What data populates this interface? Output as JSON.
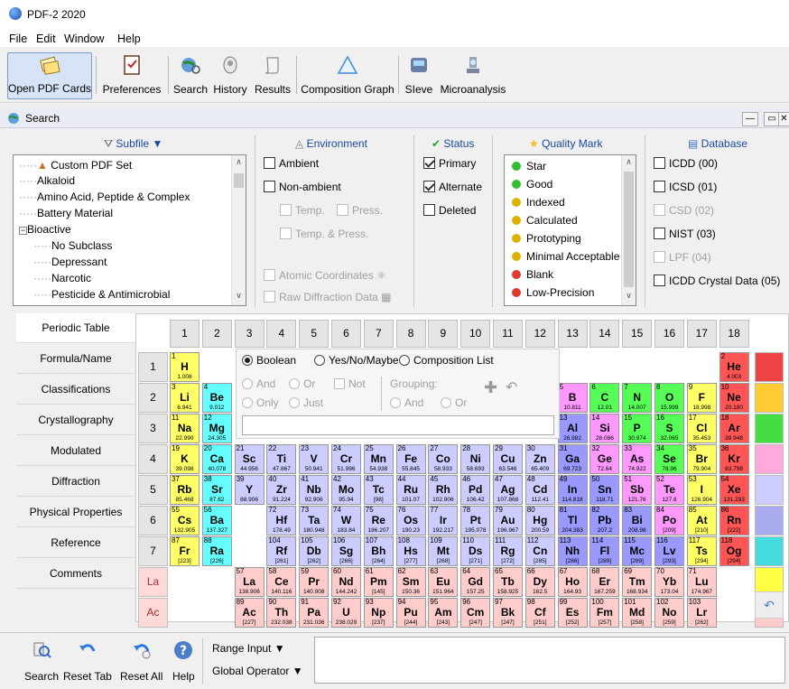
{
  "app_title": "PDF-2 2020",
  "menu": [
    "File",
    "Edit",
    "Window",
    "Help"
  ],
  "toolbar": {
    "open_pdf_cards": "Open PDF Cards",
    "preferences": "Preferences",
    "search": "Search",
    "history": "History",
    "results": "Results",
    "composition_graph": "Composition Graph",
    "sieve": "SIeve",
    "microanalysis": "Microanalysis"
  },
  "search_window": {
    "title": "Search"
  },
  "subfile": {
    "header": "Subfile ▼",
    "items": [
      "Custom PDF Set",
      "Alkaloid",
      "Amino Acid, Peptide & Complex",
      "Battery Material",
      "Bioactive",
      "No Subclass",
      "Depressant",
      "Narcotic",
      "Pesticide & Antimicrobial"
    ]
  },
  "environment": {
    "header": "Environment",
    "ambient": "Ambient",
    "non_ambient": "Non-ambient",
    "temp": "Temp.",
    "press": "Press.",
    "temp_press": "Temp. & Press.",
    "atomic_coordinates": "Atomic Coordinates",
    "raw_diffraction_data": "Raw Diffraction Data"
  },
  "status": {
    "header": "Status",
    "primary": "Primary",
    "alternate": "Alternate",
    "deleted": "Deleted"
  },
  "quality_mark": {
    "header": "Quality Mark",
    "items": [
      {
        "label": "Star",
        "color": "#2fbf2f"
      },
      {
        "label": "Good",
        "color": "#2fbf2f"
      },
      {
        "label": "Indexed",
        "color": "#e0b000"
      },
      {
        "label": "Calculated",
        "color": "#e0b000"
      },
      {
        "label": "Prototyping",
        "color": "#e0b000"
      },
      {
        "label": "Minimal Acceptable",
        "color": "#e0b000"
      },
      {
        "label": "Blank",
        "color": "#e03a2a"
      },
      {
        "label": "Low-Precision",
        "color": "#e03a2a"
      }
    ]
  },
  "database": {
    "header": "Database",
    "items": [
      "ICDD (00)",
      "ICSD (01)",
      "CSD (02)",
      "NIST (03)",
      "LPF (04)",
      "ICDD Crystal Data (05)"
    ]
  },
  "tabs": [
    "Periodic Table",
    "Formula/Name",
    "Classifications",
    "Crystallography",
    "Modulated",
    "Diffraction",
    "Physical Properties",
    "Reference",
    "Comments"
  ],
  "periodic": {
    "groups": [
      "1",
      "2",
      "3",
      "4",
      "5",
      "6",
      "7",
      "8",
      "9",
      "10",
      "11",
      "12",
      "13",
      "14",
      "15",
      "16",
      "17",
      "18"
    ],
    "periods": [
      "1",
      "2",
      "3",
      "4",
      "5",
      "6",
      "7",
      "La",
      "Ac"
    ],
    "options": {
      "boolean": "Boolean",
      "yes_no_maybe": "Yes/No/Maybe",
      "composition_list": "Composition List",
      "and": "And",
      "or": "Or",
      "not": "Not",
      "grouping": "Grouping:",
      "only": "Only",
      "just": "Just",
      "g_and": "And",
      "g_or": "Or"
    },
    "elements": [
      [
        "1",
        "H",
        "1.008",
        1,
        1,
        "y"
      ],
      [
        "2",
        "He",
        "4.003",
        18,
        1,
        "r"
      ],
      [
        "3",
        "Li",
        "6.941",
        1,
        2,
        "y"
      ],
      [
        "4",
        "Be",
        "9.012",
        2,
        2,
        "c"
      ],
      [
        "5",
        "B",
        "10.811",
        13,
        2,
        "p"
      ],
      [
        "6",
        "C",
        "12.01",
        14,
        2,
        "g"
      ],
      [
        "7",
        "N",
        "14.007",
        15,
        2,
        "g"
      ],
      [
        "8",
        "O",
        "15.999",
        16,
        2,
        "g"
      ],
      [
        "9",
        "F",
        "18.998",
        17,
        2,
        "y"
      ],
      [
        "10",
        "Ne",
        "20.180",
        18,
        2,
        "r"
      ],
      [
        "11",
        "Na",
        "22.990",
        1,
        3,
        "y"
      ],
      [
        "12",
        "Mg",
        "24.305",
        2,
        3,
        "c"
      ],
      [
        "13",
        "Al",
        "26.982",
        13,
        3,
        "b"
      ],
      [
        "14",
        "Si",
        "28.086",
        14,
        3,
        "p"
      ],
      [
        "15",
        "P",
        "30.974",
        15,
        3,
        "g"
      ],
      [
        "16",
        "S",
        "32.065",
        16,
        3,
        "g"
      ],
      [
        "17",
        "Cl",
        "35.453",
        17,
        3,
        "y"
      ],
      [
        "18",
        "Ar",
        "39.948",
        18,
        3,
        "r"
      ],
      [
        "19",
        "K",
        "39.098",
        1,
        4,
        "y"
      ],
      [
        "20",
        "Ca",
        "40.078",
        2,
        4,
        "c"
      ],
      [
        "21",
        "Sc",
        "44.956",
        3,
        4,
        "l"
      ],
      [
        "22",
        "Ti",
        "47.867",
        4,
        4,
        "l"
      ],
      [
        "23",
        "V",
        "50.941",
        5,
        4,
        "l"
      ],
      [
        "24",
        "Cr",
        "51.996",
        6,
        4,
        "l"
      ],
      [
        "25",
        "Mn",
        "54.938",
        7,
        4,
        "l"
      ],
      [
        "26",
        "Fe",
        "55.845",
        8,
        4,
        "l"
      ],
      [
        "27",
        "Co",
        "58.933",
        9,
        4,
        "l"
      ],
      [
        "28",
        "Ni",
        "58.693",
        10,
        4,
        "l"
      ],
      [
        "29",
        "Cu",
        "63.546",
        11,
        4,
        "l"
      ],
      [
        "30",
        "Zn",
        "65.409",
        12,
        4,
        "l"
      ],
      [
        "31",
        "Ga",
        "69.723",
        13,
        4,
        "b"
      ],
      [
        "32",
        "Ge",
        "72.64",
        14,
        4,
        "p"
      ],
      [
        "33",
        "As",
        "74.922",
        15,
        4,
        "p"
      ],
      [
        "34",
        "Se",
        "78.96",
        16,
        4,
        "g"
      ],
      [
        "35",
        "Br",
        "79.904",
        17,
        4,
        "y"
      ],
      [
        "36",
        "Kr",
        "83.798",
        18,
        4,
        "r"
      ],
      [
        "37",
        "Rb",
        "85.468",
        1,
        5,
        "y"
      ],
      [
        "38",
        "Sr",
        "87.62",
        2,
        5,
        "c"
      ],
      [
        "39",
        "Y",
        "88.906",
        3,
        5,
        "l"
      ],
      [
        "40",
        "Zr",
        "91.224",
        4,
        5,
        "l"
      ],
      [
        "41",
        "Nb",
        "92.906",
        5,
        5,
        "l"
      ],
      [
        "42",
        "Mo",
        "95.94",
        6,
        5,
        "l"
      ],
      [
        "43",
        "Tc",
        "[98]",
        7,
        5,
        "l"
      ],
      [
        "44",
        "Ru",
        "101.07",
        8,
        5,
        "l"
      ],
      [
        "45",
        "Rh",
        "102.906",
        9,
        5,
        "l"
      ],
      [
        "46",
        "Pd",
        "106.42",
        10,
        5,
        "l"
      ],
      [
        "47",
        "Ag",
        "107.868",
        11,
        5,
        "l"
      ],
      [
        "48",
        "Cd",
        "112.41",
        12,
        5,
        "l"
      ],
      [
        "49",
        "In",
        "114.818",
        13,
        5,
        "b"
      ],
      [
        "50",
        "Sn",
        "118.71",
        14,
        5,
        "b"
      ],
      [
        "51",
        "Sb",
        "121.76",
        15,
        5,
        "p"
      ],
      [
        "52",
        "Te",
        "127.6",
        16,
        5,
        "p"
      ],
      [
        "53",
        "I",
        "126.904",
        17,
        5,
        "y"
      ],
      [
        "54",
        "Xe",
        "131.293",
        18,
        5,
        "r"
      ],
      [
        "55",
        "Cs",
        "132.905",
        1,
        6,
        "y"
      ],
      [
        "56",
        "Ba",
        "137.327",
        2,
        6,
        "c"
      ],
      [
        "72",
        "Hf",
        "178.49",
        4,
        6,
        "l"
      ],
      [
        "73",
        "Ta",
        "180.948",
        5,
        6,
        "l"
      ],
      [
        "74",
        "W",
        "183.84",
        6,
        6,
        "l"
      ],
      [
        "75",
        "Re",
        "186.207",
        7,
        6,
        "l"
      ],
      [
        "76",
        "Os",
        "190.23",
        8,
        6,
        "l"
      ],
      [
        "77",
        "Ir",
        "192.217",
        9,
        6,
        "l"
      ],
      [
        "78",
        "Pt",
        "195.078",
        10,
        6,
        "l"
      ],
      [
        "79",
        "Au",
        "196.967",
        11,
        6,
        "l"
      ],
      [
        "80",
        "Hg",
        "200.59",
        12,
        6,
        "l"
      ],
      [
        "81",
        "Tl",
        "204.383",
        13,
        6,
        "b"
      ],
      [
        "82",
        "Pb",
        "207.2",
        14,
        6,
        "b"
      ],
      [
        "83",
        "Bi",
        "208.98",
        15,
        6,
        "b"
      ],
      [
        "84",
        "Po",
        "[209]",
        16,
        6,
        "p"
      ],
      [
        "85",
        "At",
        "[210]",
        17,
        6,
        "y"
      ],
      [
        "86",
        "Rn",
        "[222]",
        18,
        6,
        "r"
      ],
      [
        "87",
        "Fr",
        "[223]",
        1,
        7,
        "y"
      ],
      [
        "88",
        "Ra",
        "[226]",
        2,
        7,
        "c"
      ],
      [
        "104",
        "Rf",
        "[261]",
        4,
        7,
        "l"
      ],
      [
        "105",
        "Db",
        "[262]",
        5,
        7,
        "l"
      ],
      [
        "106",
        "Sg",
        "[266]",
        6,
        7,
        "l"
      ],
      [
        "107",
        "Bh",
        "[264]",
        7,
        7,
        "l"
      ],
      [
        "108",
        "Hs",
        "[277]",
        8,
        7,
        "l"
      ],
      [
        "109",
        "Mt",
        "[268]",
        9,
        7,
        "l"
      ],
      [
        "110",
        "Ds",
        "[271]",
        10,
        7,
        "l"
      ],
      [
        "111",
        "Rg",
        "[272]",
        11,
        7,
        "l"
      ],
      [
        "112",
        "Cn",
        "[285]",
        12,
        7,
        "l"
      ],
      [
        "113",
        "Nh",
        "[286]",
        13,
        7,
        "b"
      ],
      [
        "114",
        "Fl",
        "[289]",
        14,
        7,
        "b"
      ],
      [
        "115",
        "Mc",
        "[289]",
        15,
        7,
        "b"
      ],
      [
        "116",
        "Lv",
        "[293]",
        16,
        7,
        "b"
      ],
      [
        "117",
        "Ts",
        "[294]",
        17,
        7,
        "y"
      ],
      [
        "118",
        "Og",
        "[294]",
        18,
        7,
        "r"
      ],
      [
        "57",
        "La",
        "138.906",
        3,
        8,
        "k"
      ],
      [
        "58",
        "Ce",
        "140.116",
        4,
        8,
        "k"
      ],
      [
        "59",
        "Pr",
        "140.908",
        5,
        8,
        "k"
      ],
      [
        "60",
        "Nd",
        "144.242",
        6,
        8,
        "k"
      ],
      [
        "61",
        "Pm",
        "[145]",
        7,
        8,
        "k"
      ],
      [
        "62",
        "Sm",
        "150.36",
        8,
        8,
        "k"
      ],
      [
        "63",
        "Eu",
        "151.964",
        9,
        8,
        "k"
      ],
      [
        "64",
        "Gd",
        "157.25",
        10,
        8,
        "k"
      ],
      [
        "65",
        "Tb",
        "158.925",
        11,
        8,
        "k"
      ],
      [
        "66",
        "Dy",
        "162.5",
        12,
        8,
        "k"
      ],
      [
        "67",
        "Ho",
        "164.93",
        13,
        8,
        "k"
      ],
      [
        "68",
        "Er",
        "167.259",
        14,
        8,
        "k"
      ],
      [
        "69",
        "Tm",
        "168.934",
        15,
        8,
        "k"
      ],
      [
        "70",
        "Yb",
        "173.04",
        16,
        8,
        "k"
      ],
      [
        "71",
        "Lu",
        "174.967",
        17,
        8,
        "k"
      ],
      [
        "89",
        "Ac",
        "[227]",
        3,
        9,
        "k"
      ],
      [
        "90",
        "Th",
        "232.038",
        4,
        9,
        "k"
      ],
      [
        "91",
        "Pa",
        "231.036",
        5,
        9,
        "k"
      ],
      [
        "92",
        "U",
        "238.029",
        6,
        9,
        "k"
      ],
      [
        "93",
        "Np",
        "[237]",
        7,
        9,
        "k"
      ],
      [
        "94",
        "Pu",
        "[244]",
        8,
        9,
        "k"
      ],
      [
        "95",
        "Am",
        "[243]",
        9,
        9,
        "k"
      ],
      [
        "96",
        "Cm",
        "[247]",
        10,
        9,
        "k"
      ],
      [
        "97",
        "Bk",
        "[247]",
        11,
        9,
        "k"
      ],
      [
        "98",
        "Cf",
        "[251]",
        12,
        9,
        "k"
      ],
      [
        "99",
        "Es",
        "[252]",
        13,
        9,
        "k"
      ],
      [
        "100",
        "Fm",
        "[257]",
        14,
        9,
        "k"
      ],
      [
        "101",
        "Md",
        "[258]",
        15,
        9,
        "k"
      ],
      [
        "102",
        "No",
        "[259]",
        16,
        9,
        "k"
      ],
      [
        "103",
        "Lr",
        "[262]",
        17,
        9,
        "k"
      ]
    ],
    "colors": {
      "y": "#ffff66",
      "c": "#66ffff",
      "r": "#ff5555",
      "p": "#ff99ff",
      "g": "#55ff55",
      "b": "#9999ff",
      "l": "#ccccff",
      "k": "#ffcccc"
    },
    "legend_colors": [
      "#ee4444",
      "#ffcc33",
      "#44dd44",
      "#ffaadd",
      "#ccccff",
      "#aaaaee",
      "#44dddd",
      "#ffff44",
      "#ffcccc"
    ]
  },
  "bottom": {
    "search": "Search",
    "reset_tab": "Reset Tab",
    "reset_all": "Reset All",
    "help": "Help",
    "range_input": "Range Input ▼",
    "global_operator": "Global Operator ▼"
  }
}
